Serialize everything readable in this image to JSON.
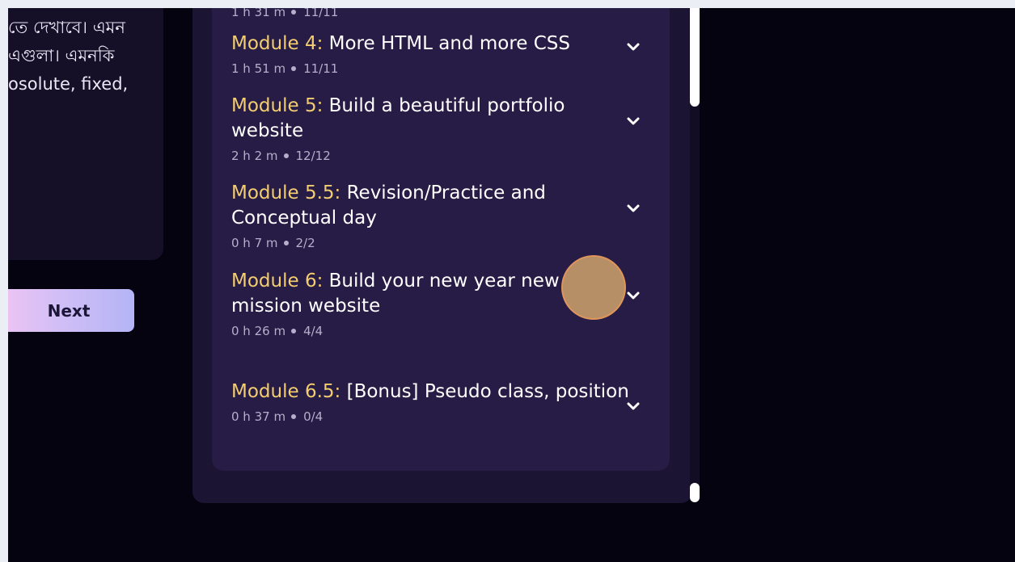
{
  "description": {
    "lines_text": "seudo class\nতে দেখাবে। এমন\n এগুলা। এমনকি\nosolute, fixed,"
  },
  "navigation": {
    "next_label": "Next"
  },
  "modules": [
    {
      "prefix": "",
      "title": "",
      "meta_time": "1 h 31 m",
      "meta_progress": "11/11"
    },
    {
      "prefix": "Module 4:",
      "title": " More HTML and more CSS",
      "meta_time": "1 h 51 m",
      "meta_progress": "11/11"
    },
    {
      "prefix": "Module 5:",
      "title": " Build a beautiful portfolio website",
      "meta_time": "2 h 2 m",
      "meta_progress": "12/12"
    },
    {
      "prefix": "Module 5.5:",
      "title": " Revision/Practice and Conceptual day",
      "meta_time": "0 h 7 m",
      "meta_progress": "2/2"
    },
    {
      "prefix": "Module 6:",
      "title": " Build your new year new mission website",
      "meta_time": "0 h 26 m",
      "meta_progress": "4/4"
    },
    {
      "prefix": "Module 6.5:",
      "title": " [Bonus] Pseudo class, position",
      "meta_time": "0 h 37 m",
      "meta_progress": "0/4"
    }
  ],
  "icons": {
    "expand": "chevron-down-icon"
  },
  "colors": {
    "background": "#04030f",
    "panel": "#1b1432",
    "card": "#271c45",
    "accent_yellow": "#f3cd6f",
    "next_gradient_start": "#f1c5f3",
    "next_gradient_end": "#b4b4f6"
  }
}
